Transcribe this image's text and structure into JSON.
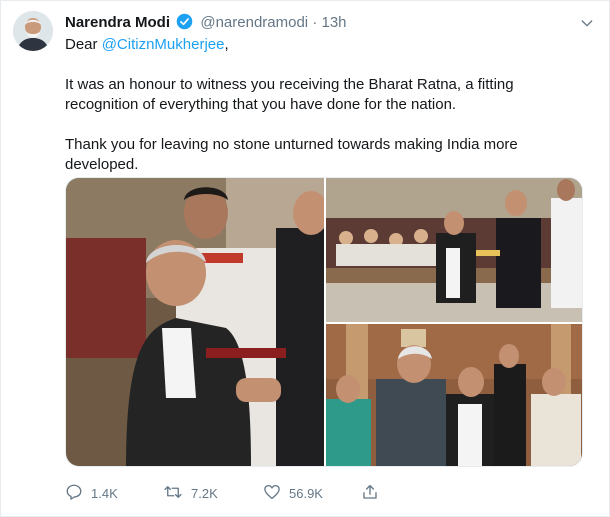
{
  "tweet": {
    "author_name": "Narendra Modi",
    "handle": "@narendramodi",
    "separator": "·",
    "time": "13h",
    "greeting": "Dear ",
    "mention": "@CitiznMukherjee",
    "greeting_end": ",",
    "paragraph_1": "It was an honour to witness you receiving the Bharat Ratna, a fitting recognition of everything that you have done for the nation.",
    "paragraph_2": "Thank you for leaving no stone unturned towards making India more developed."
  },
  "actions": {
    "reply_count": "1.4K",
    "retweet_count": "7.2K",
    "like_count": "56.9K"
  },
  "icons": {
    "verified": "verified-badge-icon",
    "more": "chevron-down-icon",
    "reply": "reply-icon",
    "retweet": "retweet-icon",
    "like": "heart-icon",
    "share": "share-icon"
  },
  "colors": {
    "accent": "#1da1f2",
    "secondary_text": "#657786",
    "primary_text": "#14171a"
  }
}
